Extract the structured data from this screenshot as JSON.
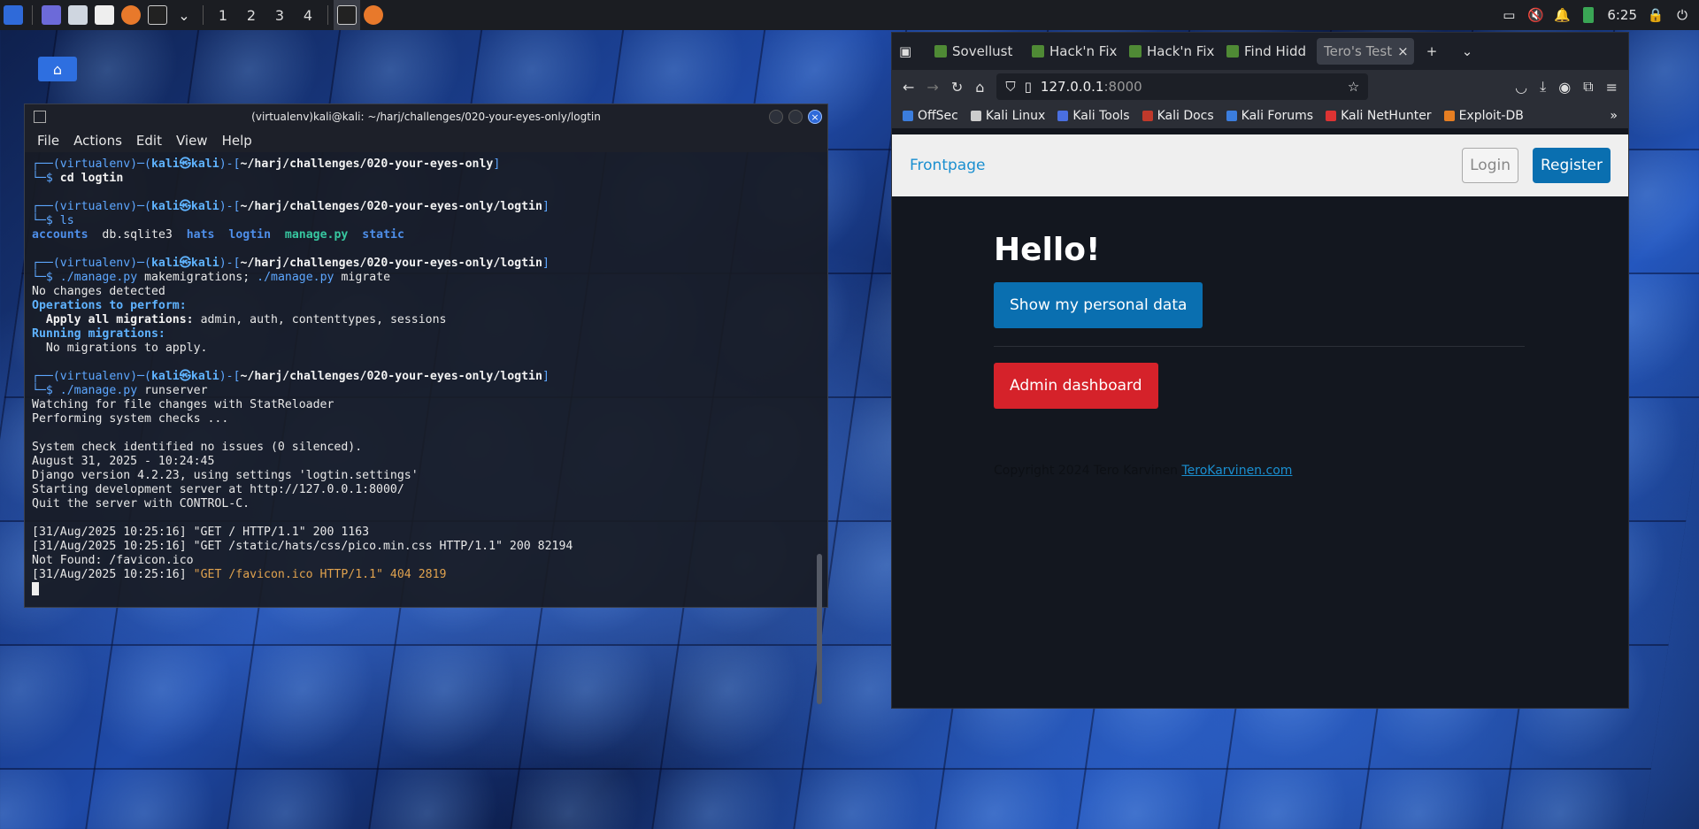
{
  "taskbar": {
    "workspaces": [
      "1",
      "2",
      "3",
      "4"
    ],
    "clock": "6:25"
  },
  "terminal": {
    "title": "(virtualenv)kali@kali: ~/harj/challenges/020-your-eyes-only/logtin",
    "menu": [
      "File",
      "Actions",
      "Edit",
      "View",
      "Help"
    ],
    "prompt_prefix": "(virtualenv)─(",
    "user": "kali㉿kali",
    "prompt_mid": ")-[",
    "prompt_end": "]",
    "dollar": "$",
    "path1": "~/harj/challenges/020-your-eyes-only",
    "path2": "~/harj/challenges/020-your-eyes-only/logtin",
    "cmd1": "cd logtin",
    "cmd2": "ls",
    "ls_items": [
      "accounts",
      "db.sqlite3",
      "hats",
      "logtin",
      "manage.py",
      "static"
    ],
    "cmd3a": "./manage.py",
    "cmd3b": "makemigrations;",
    "cmd3c": "./manage.py",
    "cmd3d": "migrate",
    "out_no_changes": "No changes detected",
    "out_ops": "Operations to perform:",
    "out_apply_label": "Apply all migrations:",
    "out_apply_list": "admin, auth, contenttypes, sessions",
    "out_running": "Running migrations:",
    "out_no_mig": "No migrations to apply.",
    "cmd4a": "./manage.py",
    "cmd4b": "runserver",
    "log": [
      "Watching for file changes with StatReloader",
      "Performing system checks ...",
      "",
      "System check identified no issues (0 silenced).",
      "August 31, 2025 - 10:24:45",
      "Django version 4.2.23, using settings 'logtin.settings'",
      "Starting development server at http://127.0.0.1:8000/",
      "Quit the server with CONTROL-C.",
      "",
      "[31/Aug/2025 10:25:16] \"GET / HTTP/1.1\" 200 1163",
      "[31/Aug/2025 10:25:16] \"GET /static/hats/css/pico.min.css HTTP/1.1\" 200 82194",
      "Not Found: /favicon.ico"
    ],
    "log_last_prefix": "[31/Aug/2025 10:25:16] ",
    "log_last_err": "\"GET /favicon.ico HTTP/1.1\" 404 2819"
  },
  "browser": {
    "tabs": [
      "Sovellust",
      "Hack'n Fix",
      "Hack'n Fix",
      "Find Hidd",
      "Tero's Test"
    ],
    "url_host": "127.0.0.1",
    "url_port": ":8000",
    "bookmarks": [
      "OffSec",
      "Kali Linux",
      "Kali Tools",
      "Kali Docs",
      "Kali Forums",
      "Kali NetHunter",
      "Exploit-DB"
    ],
    "bookmark_colors": [
      "#3b7ddd",
      "#cccccc",
      "#4a6fe0",
      "#c0392b",
      "#3b7ddd",
      "#d33",
      "#e67e22"
    ]
  },
  "site": {
    "brand": "Frontpage",
    "login": "Login",
    "register": "Register",
    "heading": "Hello!",
    "personal_btn": "Show my personal data",
    "admin_btn": "Admin dashboard",
    "footer_text": "Copyright 2024 Tero Karvinen",
    "footer_link": "TeroKarvinen.com"
  }
}
